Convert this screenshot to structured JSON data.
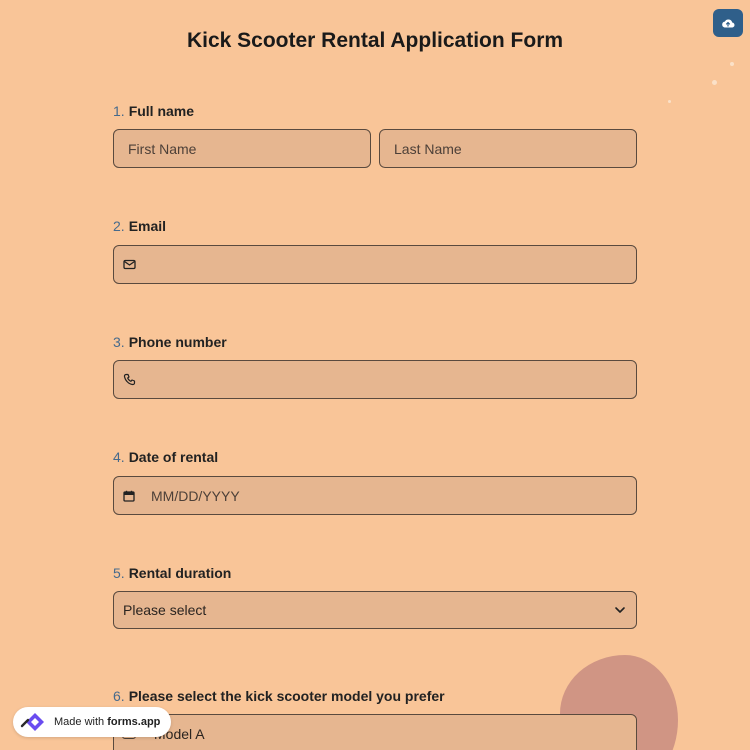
{
  "form": {
    "title": "Kick Scooter Rental Application Form"
  },
  "questions": [
    {
      "number": "1.",
      "label": "Full name",
      "first_placeholder": "First Name",
      "last_placeholder": "Last Name"
    },
    {
      "number": "2.",
      "label": "Email",
      "icon": "envelope-icon"
    },
    {
      "number": "3.",
      "label": "Phone number",
      "icon": "phone-icon"
    },
    {
      "number": "4.",
      "label": "Date of rental",
      "icon": "calendar-icon",
      "placeholder": "MM/DD/YYYY"
    },
    {
      "number": "5.",
      "label": "Rental duration",
      "selected": "Please select"
    },
    {
      "number": "6.",
      "label": "Please select the kick scooter model you prefer",
      "first_option": "Model A"
    }
  ],
  "badge": {
    "prefix": "Made with ",
    "brand": "forms.app"
  },
  "colors": {
    "background": "#f9c598",
    "field": "#e6b690",
    "accent": "#466a8c",
    "upload_button": "#2f5f8a"
  },
  "icons": {
    "upload": "cloud-upload-icon",
    "dropdown": "chevron-down-icon",
    "logo": "forms-app-logo"
  }
}
